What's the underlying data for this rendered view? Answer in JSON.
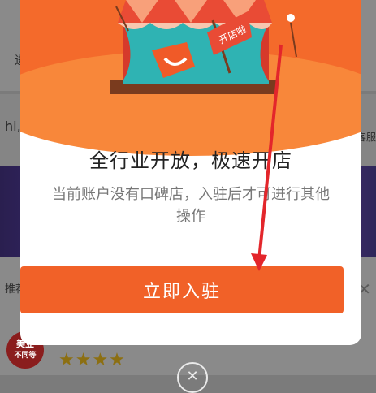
{
  "background": {
    "top_left_text": "进",
    "row2_left_text": "hi,",
    "row2_right_text": "客服",
    "recommend_text": "推荐",
    "badge_line1": "美业",
    "badge_line2": "不同等",
    "stars": "★★★★"
  },
  "modal": {
    "flag_text": "开店啦",
    "headline": "全行业开放，极速开店",
    "subtext": "当前账户没有口碑店，入驻后才可进行其他操作",
    "cta_label": "立即入驻",
    "close_icon": "close-circle-icon"
  },
  "annotation": {
    "arrow_color": "#e3262b"
  }
}
